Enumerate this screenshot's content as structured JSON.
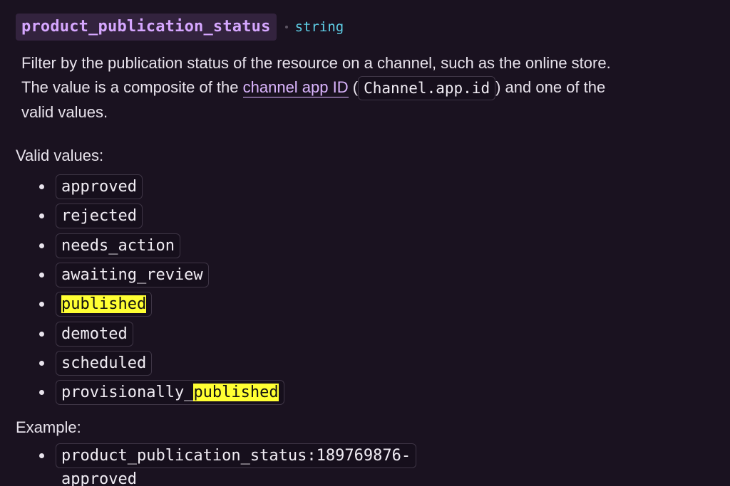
{
  "param": {
    "name": "product_publication_status",
    "type": "string"
  },
  "description": {
    "line1": "Filter by the publication status of the resource on a channel, such as the online store.",
    "line2_prefix": "The value is a composite of the ",
    "link_text": "channel app ID",
    "paren_open": " (",
    "code": "Channel.app.id",
    "paren_close": ")",
    "line2_suffix": " and one of the",
    "line3": "valid values."
  },
  "valid_values": {
    "label": "Valid values:",
    "items": [
      {
        "value": "approved"
      },
      {
        "value": "rejected"
      },
      {
        "value": "needs_action"
      },
      {
        "value": "awaiting_review"
      },
      {
        "value": "published",
        "highlight": "published"
      },
      {
        "value": "demoted"
      },
      {
        "value": "scheduled"
      },
      {
        "value": "provisionally_published",
        "prefix": "provisionally_",
        "highlight": "published"
      }
    ]
  },
  "example": {
    "label": "Example:",
    "items": [
      {
        "value": "product_publication_status:189769876-approved"
      }
    ]
  }
}
